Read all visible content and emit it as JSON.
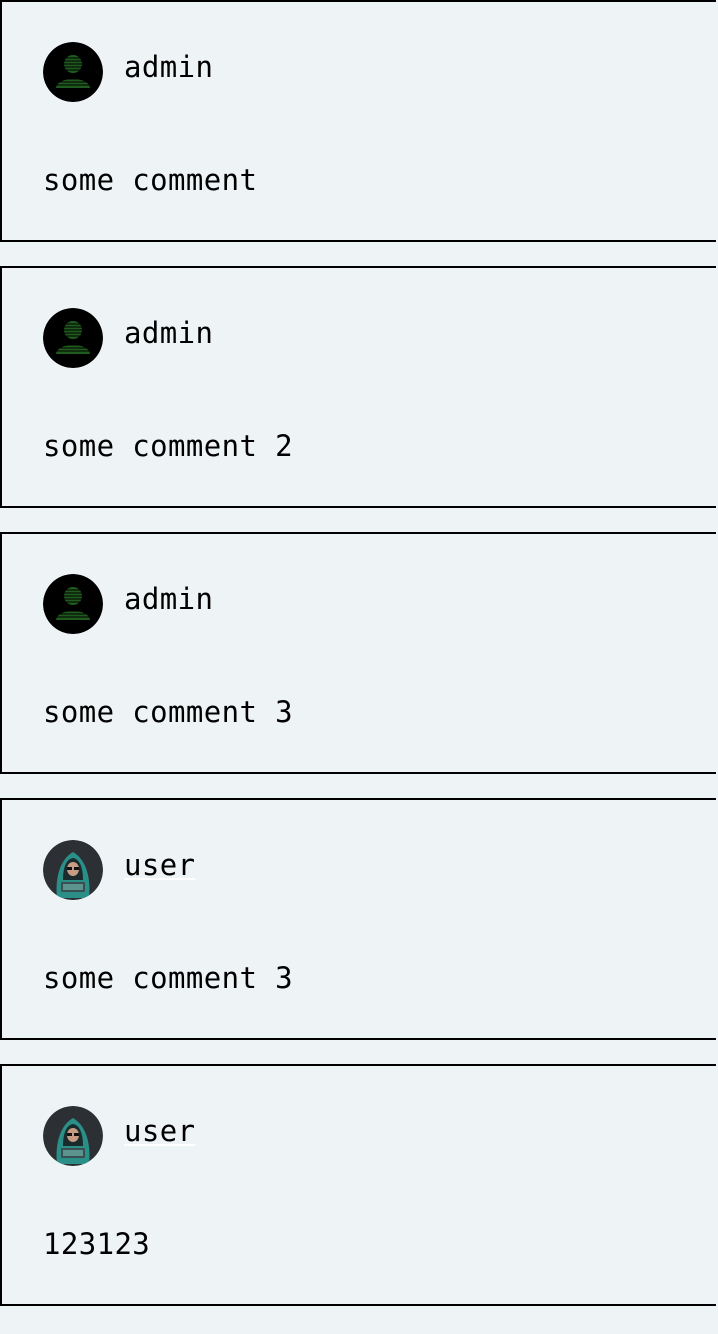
{
  "comments": [
    {
      "author": "admin",
      "text": "some comment",
      "avatar": "admin-avatar-icon"
    },
    {
      "author": "admin",
      "text": "some comment 2",
      "avatar": "admin-avatar-icon"
    },
    {
      "author": "admin",
      "text": "some comment 3",
      "avatar": "admin-avatar-icon"
    },
    {
      "author": "user",
      "text": "some comment 3",
      "avatar": "hooded-hacker-avatar-icon"
    },
    {
      "author": "user",
      "text": "123123",
      "avatar": "hooded-hacker-avatar-icon"
    }
  ],
  "colors": {
    "page_background": "#eef3f6",
    "card_border": "#000000",
    "admin_avatar_bg": "#000000",
    "admin_avatar_glyph": "#1f5a1f",
    "user_avatar_hood": "#2a8f86"
  }
}
